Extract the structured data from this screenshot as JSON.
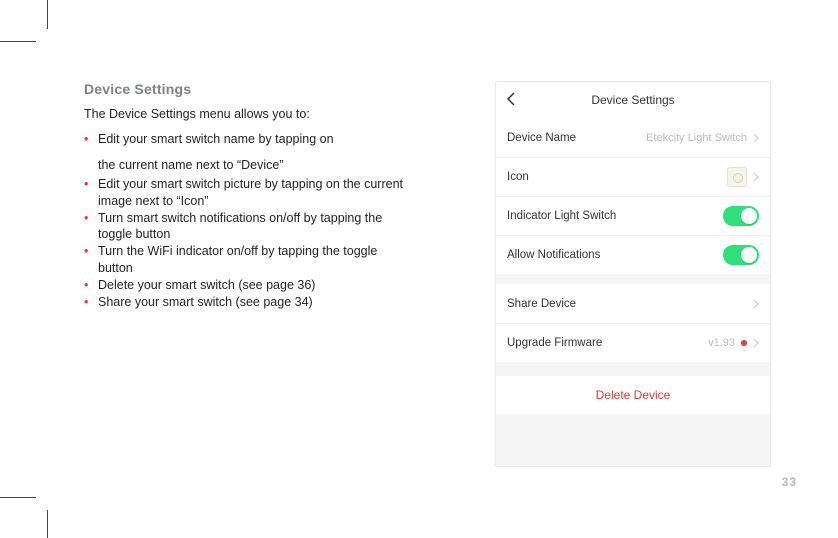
{
  "section_title": "Device Settings",
  "intro": "The Device Settings menu allows you to:",
  "bullets": {
    "b1a": "Edit your smart switch name by tapping on",
    "b1b": "the current name next to “Device”",
    "b2": "Edit your smart switch picture by tapping on the current image next to “Icon”",
    "b3": "Turn smart switch notifications on/off by tapping the toggle button",
    "b4": "Turn the WiFi indicator on/off by tapping the toggle button",
    "b5": "Delete your smart switch (see page 36)",
    "b6": "Share your smart switch (see page 34)"
  },
  "phone": {
    "header_title": "Device Settings",
    "rows": {
      "device_name_label": "Device Name",
      "device_name_value": "Etekcity Light Switch",
      "icon_label": "Icon",
      "indicator_label": "Indicator Light Switch",
      "notif_label": "Allow Notifications",
      "share_label": "Share Device",
      "upgrade_label": "Upgrade Firmware",
      "upgrade_value": "v1.93",
      "delete_label": "Delete Device"
    }
  },
  "page_number": "33"
}
